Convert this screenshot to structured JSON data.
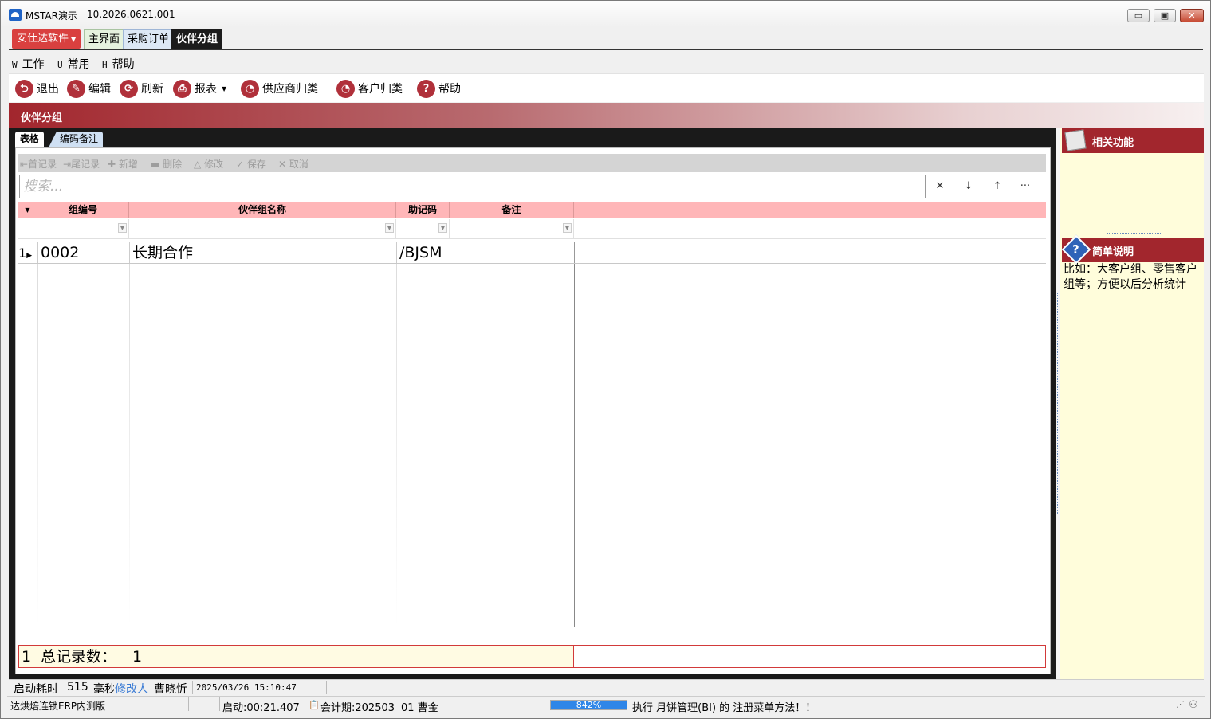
{
  "window": {
    "title": "MSTAR演示",
    "version": "10.2026.0621.001",
    "buttons": {
      "minimize": "▭",
      "maximize": "▣",
      "close": "✕"
    }
  },
  "topstrip": {
    "brand": "安仕达软件",
    "tabs": [
      "主界面",
      "采购订单",
      "伙伴分组"
    ]
  },
  "menu": [
    {
      "acc": "W",
      "label": "工作"
    },
    {
      "acc": "U",
      "label": "常用"
    },
    {
      "acc": "H",
      "label": "帮助"
    }
  ],
  "toolbar": [
    {
      "label": "退出",
      "icon": "exit-icon",
      "glyph": "⮌"
    },
    {
      "label": "编辑",
      "icon": "edit-icon",
      "glyph": "✎"
    },
    {
      "label": "刷新",
      "icon": "refresh-icon",
      "glyph": "⟳"
    },
    {
      "label": "报表",
      "icon": "print-icon",
      "glyph": "⎙"
    },
    {
      "label": "供应商归类",
      "icon": "pie-chart-icon",
      "glyph": "◔"
    },
    {
      "label": "客户归类",
      "icon": "pie-chart-icon",
      "glyph": "◔"
    },
    {
      "label": "帮助",
      "icon": "help-icon",
      "glyph": "?"
    }
  ],
  "section_title": "伙伴分组",
  "subtabs": [
    "表格",
    "编码备注"
  ],
  "recnav": [
    "首记录",
    "尾记录",
    "新增",
    "删除",
    "修改",
    "保存",
    "取消"
  ],
  "search": {
    "placeholder": "搜索...",
    "buttons": [
      "✕",
      "↓",
      "↑",
      "···"
    ]
  },
  "grid": {
    "columns": [
      "组编号",
      "伙伴组名称",
      "助记码",
      "备注"
    ],
    "rows": [
      {
        "index": "1",
        "code": "0002",
        "name": "长期合作",
        "mnemonic": "/BJSM",
        "remark": ""
      }
    ],
    "footer": {
      "index": "1",
      "label": "总记录数：",
      "count": "1"
    }
  },
  "sidepanel": {
    "related_title": "相关功能",
    "desc_title": "简单说明",
    "desc_text": "比如：大客户组、零售客户组等；方便以后分析统计"
  },
  "status1": {
    "startup_label": "启动耗时",
    "startup_value": "515",
    "startup_unit": "毫秒",
    "modifier_label": "修改人",
    "modifier_name": "曹晓忻",
    "modified_time": "2025/03/26 15:10:47"
  },
  "status2": {
    "edition": "达烘焙连锁ERP内测版",
    "uptime": "启动:00:21.407",
    "period": "会计期:202503",
    "user": "01 曹金",
    "progress_percent": 842,
    "progress_label": "842%",
    "message": "执行 月饼管理(BI) 的 注册菜单方法！！"
  }
}
